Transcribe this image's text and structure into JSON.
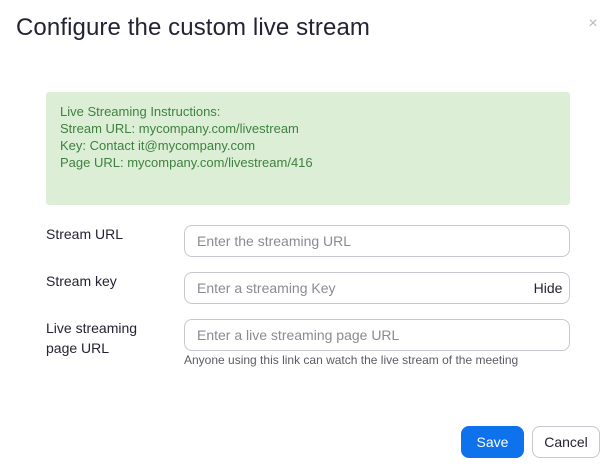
{
  "dialog": {
    "title": "Configure the custom live stream",
    "close_glyph": "×",
    "close_icon": "close-icon"
  },
  "instructions": {
    "lines": [
      "Live Streaming Instructions:",
      "Stream URL: mycompany.com/livestream",
      "Key: Contact it@mycompany.com",
      "Page URL: mycompany.com/livestream/416"
    ],
    "background_color": "#dcefd6",
    "text_color": "#3f8040"
  },
  "form": {
    "stream_url": {
      "label": "Stream URL",
      "value": "",
      "placeholder": "Enter the streaming URL"
    },
    "stream_key": {
      "label": "Stream key",
      "value": "",
      "placeholder": "Enter a streaming Key",
      "toggle_label": "Hide"
    },
    "page_url": {
      "label_line1": "Live streaming",
      "label_line2": "page URL",
      "value": "",
      "placeholder": "Enter a live streaming page URL",
      "hint": "Anyone using this link can watch the live stream of the meeting"
    }
  },
  "footer": {
    "save_label": "Save",
    "cancel_label": "Cancel",
    "accent_color": "#0e72ed"
  }
}
